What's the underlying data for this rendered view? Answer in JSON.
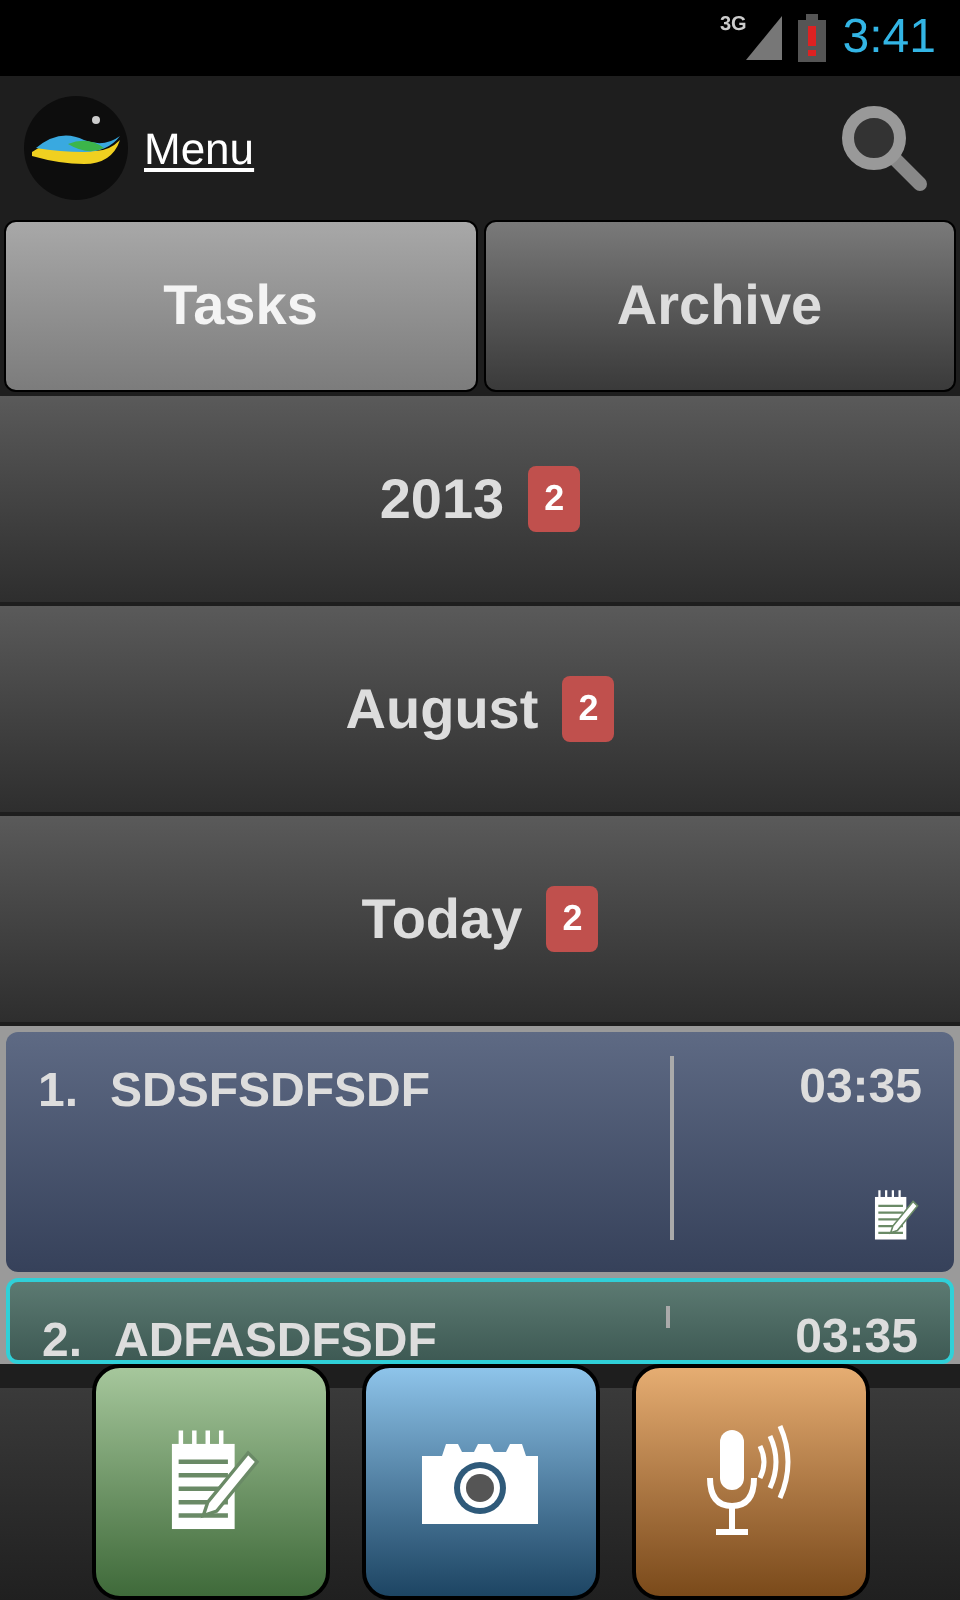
{
  "status_bar": {
    "network": "3G",
    "time": "3:41"
  },
  "action_bar": {
    "title": "Menu"
  },
  "tabs": [
    {
      "label": "Tasks",
      "selected": true
    },
    {
      "label": "Archive",
      "selected": false
    }
  ],
  "groups": [
    {
      "label": "2013",
      "count": "2"
    },
    {
      "label": "August",
      "count": "2"
    },
    {
      "label": "Today",
      "count": "2"
    }
  ],
  "tasks": [
    {
      "number": "1.",
      "title": "SDSFSDFSDF",
      "time": "03:35",
      "selected": false,
      "has_note": true
    },
    {
      "number": "2.",
      "title": "ADFASDFSDF",
      "time": "03:35",
      "selected": true
    }
  ],
  "toolbar": [
    {
      "kind": "note"
    },
    {
      "kind": "camera"
    },
    {
      "kind": "voice"
    }
  ]
}
